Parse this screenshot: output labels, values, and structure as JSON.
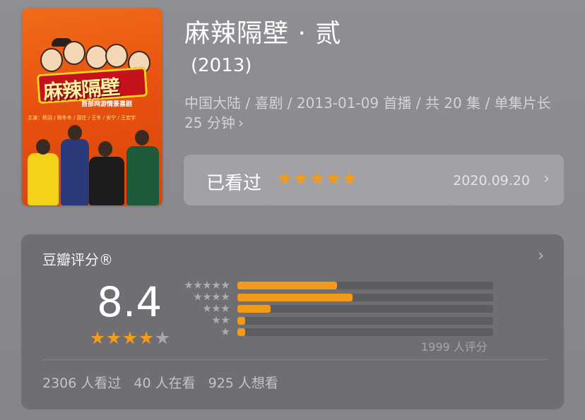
{
  "poster": {
    "title_art": "麻辣隔壁",
    "subtitle": "首部网游情景喜剧",
    "cast_line": "主演：杨羽 / 杨冬冬 / 邵庄 / 王冬 / 安宁 / 王宏宇"
  },
  "show": {
    "title": "麻辣隔壁 · 贰",
    "year": "(2013)",
    "meta": "中国大陆 / 喜剧 / 2013-01-09 首播 / 共 20 集 / 单集片长 25 分钟",
    "meta_chevron": "›"
  },
  "watched": {
    "label": "已看过",
    "stars": 5,
    "date": "2020.09.20",
    "chevron": "›"
  },
  "rating": {
    "title": "豆瓣评分®",
    "chevron": "›",
    "score": "8.4",
    "score_stars": 4,
    "distribution": [
      {
        "stars": 5,
        "fraction": 0.39
      },
      {
        "stars": 4,
        "fraction": 0.45
      },
      {
        "stars": 3,
        "fraction": 0.13
      },
      {
        "stars": 2,
        "fraction": 0.03
      },
      {
        "stars": 1,
        "fraction": 0.03
      }
    ],
    "count": "1999 人评分",
    "footer": {
      "watched": "2306 人看过",
      "watching": "40 人在看",
      "want": "925 人想看"
    }
  },
  "colors": {
    "accent": "#f39a1a",
    "card_bg": "#6f6e73"
  }
}
